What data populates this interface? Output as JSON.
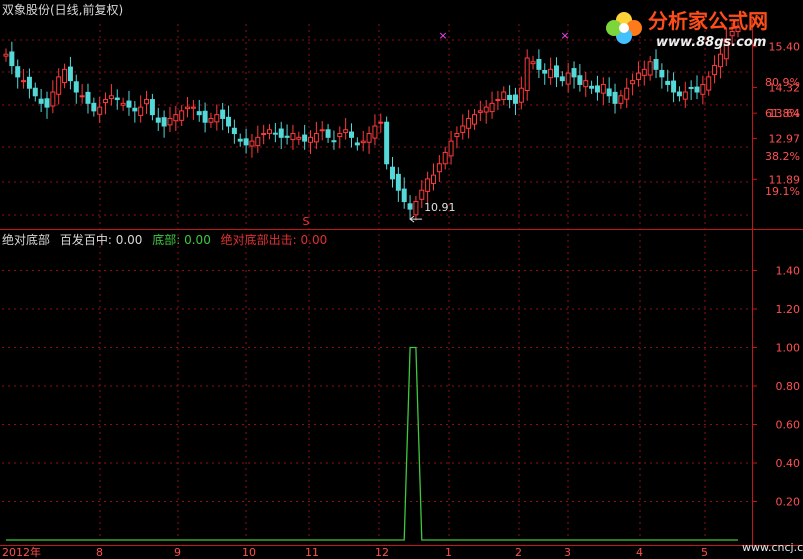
{
  "window": {
    "title": "双象股份(日线,前复权)"
  },
  "logo": {
    "main": "分析家公式网",
    "url": "www.88gs.com"
  },
  "watermark": "www.cncj.com",
  "chart_data": [
    {
      "type": "candlestick",
      "price_ticks": [
        "15.40",
        "14.32",
        "13.64",
        "12.97",
        "11.89"
      ],
      "pct_ticks": [
        "80.9%",
        "61.8%",
        "38.2%",
        "19.1%"
      ],
      "annotations": {
        "low_value": "10.91",
        "signal_mark": "S",
        "star_mark": "×"
      },
      "ylim": [
        10.6,
        16.0
      ],
      "closes": [
        15.2,
        14.9,
        14.6,
        14.5,
        14.3,
        14.1,
        13.9,
        13.8,
        14.2,
        14.6,
        14.8,
        14.5,
        14.2,
        14.1,
        13.9,
        13.7,
        13.8,
        14.0,
        14.1,
        14.0,
        13.9,
        13.8,
        13.7,
        13.8,
        14.0,
        13.6,
        13.4,
        13.3,
        13.5,
        13.6,
        13.7,
        13.8,
        13.8,
        13.6,
        13.4,
        13.5,
        13.6,
        13.5,
        13.3,
        13.1,
        12.9,
        12.8,
        12.9,
        13.0,
        13.1,
        13.2,
        13.1,
        13.0,
        13.0,
        13.1,
        13.0,
        12.9,
        13.0,
        13.1,
        13.2,
        13.0,
        12.9,
        13.1,
        13.2,
        13.0,
        12.8,
        12.9,
        13.1,
        13.3,
        13.4,
        12.3,
        11.9,
        11.6,
        11.3,
        11.1,
        11.3,
        11.6,
        11.9,
        12.0,
        12.3,
        12.6,
        12.9,
        13.1,
        13.3,
        13.5,
        13.6,
        13.7,
        13.8,
        13.9,
        14.0,
        14.2,
        14.0,
        13.9,
        14.3,
        15.1,
        15.0,
        14.8,
        14.7,
        14.8,
        14.6,
        14.5,
        14.7,
        14.6,
        14.4,
        14.5,
        14.3,
        14.2,
        14.4,
        14.1,
        13.9,
        14.1,
        14.3,
        14.5,
        14.7,
        14.8,
        15.0,
        14.8,
        14.6,
        14.4,
        14.2,
        14.1,
        14.2,
        14.3,
        14.2,
        14.4,
        14.6,
        14.9,
        15.2,
        15.6,
        15.8,
        15.9
      ]
    },
    {
      "type": "line",
      "legend": [
        {
          "name": "绝对底部",
          "color": "#d8d8d8"
        },
        {
          "name": "百发百中: 0.00",
          "color": "#d8d8d8"
        },
        {
          "name": "底部: 0.00",
          "color": "#3ec83e"
        },
        {
          "name": "绝对底部出击: 0.00",
          "color": "#e03030"
        }
      ],
      "y_ticks": [
        "1.40",
        "1.20",
        "1.00",
        "0.80",
        "0.60",
        "0.40",
        "0.20"
      ],
      "ylim": [
        0,
        1.6
      ],
      "x_labels": [
        "2012年",
        "8",
        "9",
        "10",
        "11",
        "12",
        "1",
        "2",
        "3",
        "4",
        "5"
      ],
      "signal_value": 1.0,
      "signal_bar_index": 69
    }
  ],
  "colors": {
    "up": "#ff3b3b",
    "down": "#54d8d8",
    "grid": "#8b1010",
    "axis": "#c01818",
    "signal": "#3ec83e"
  }
}
